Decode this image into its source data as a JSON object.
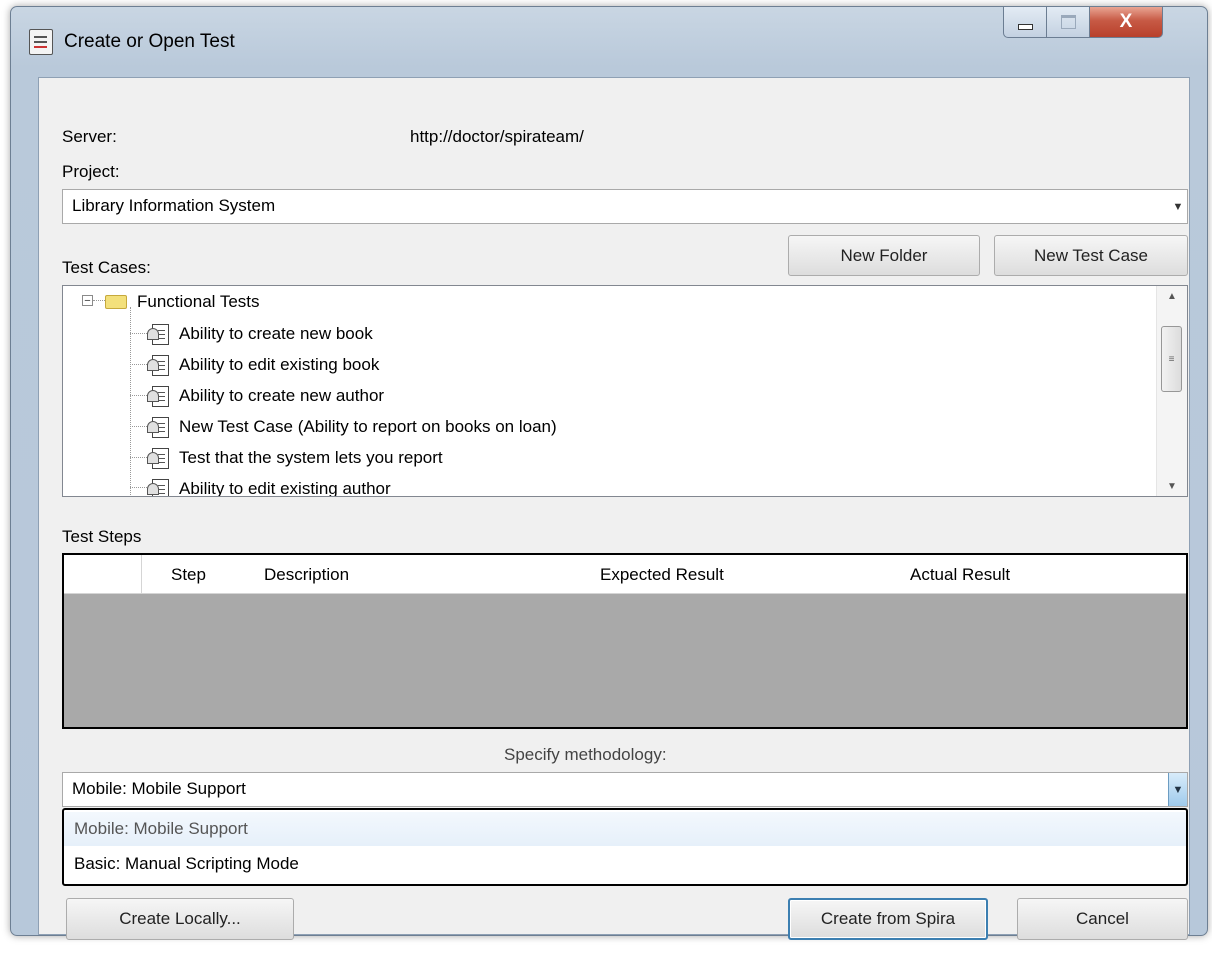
{
  "window": {
    "title": "Create or Open Test",
    "close_glyph": "X"
  },
  "server": {
    "label": "Server:",
    "value": "http://doctor/spirateam/"
  },
  "project": {
    "label": "Project:",
    "selected": "Library Information System"
  },
  "test_cases": {
    "label": "Test Cases:",
    "new_folder_label": "New Folder",
    "new_test_case_label": "New Test Case",
    "folder": {
      "name": "Functional Tests",
      "icon": "folder-icon",
      "expander": "−"
    },
    "items": [
      {
        "name": "Ability to create new book",
        "icon": "test-case-icon"
      },
      {
        "name": "Ability to edit existing book",
        "icon": "test-case-icon"
      },
      {
        "name": "Ability to create new author",
        "icon": "test-case-icon"
      },
      {
        "name": "New Test Case (Ability to report on books on loan)",
        "icon": "test-case-icon"
      },
      {
        "name": "Test that the system lets you report",
        "icon": "test-case-icon"
      },
      {
        "name": "Ability to edit existing author",
        "icon": "test-case-icon"
      }
    ]
  },
  "test_steps": {
    "label": "Test Steps",
    "columns": [
      "Step",
      "Description",
      "Expected Result",
      "Actual Result"
    ]
  },
  "methodology": {
    "label": "Specify methodology:",
    "selected": "Mobile: Mobile Support",
    "options": [
      "Mobile: Mobile Support",
      "Basic: Manual Scripting Mode"
    ]
  },
  "buttons": {
    "create_locally": "Create Locally...",
    "create_from_spira": "Create from Spira",
    "cancel": "Cancel"
  }
}
